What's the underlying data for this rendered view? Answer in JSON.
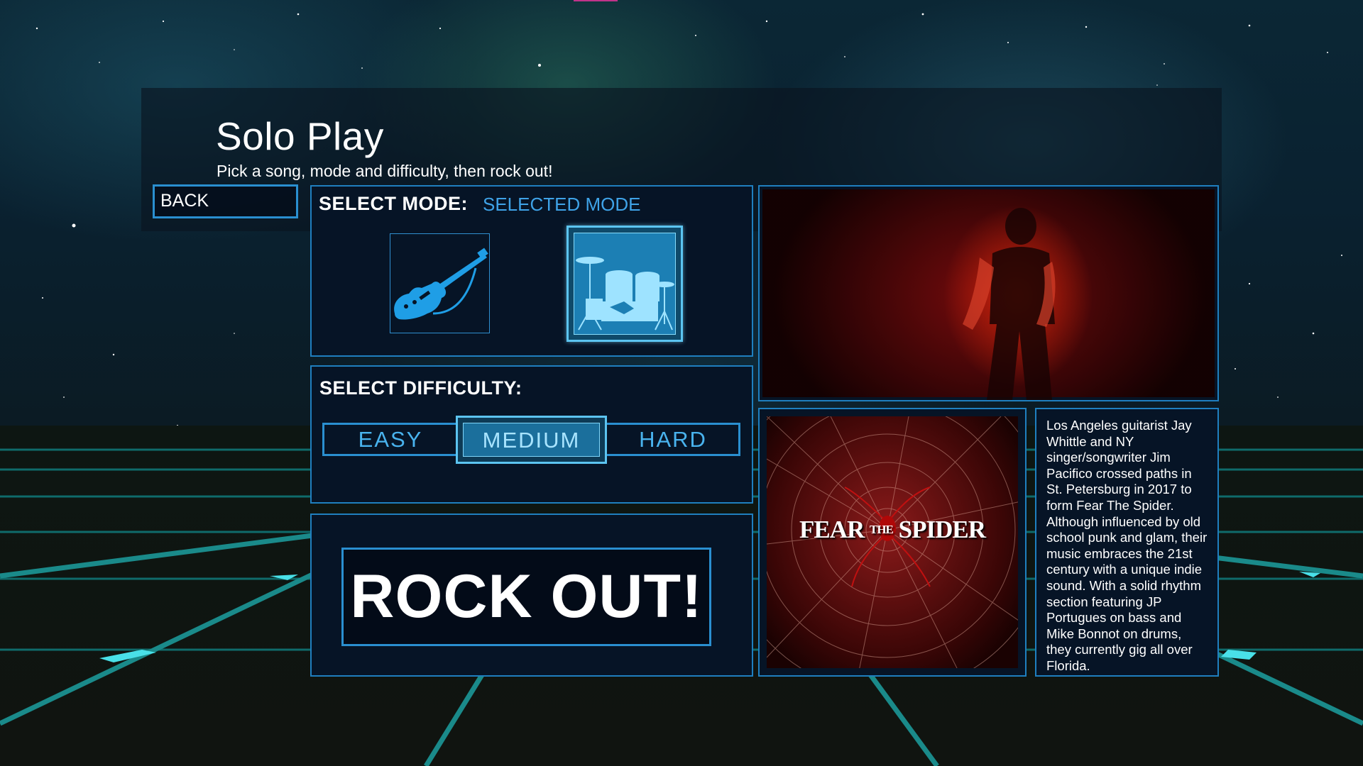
{
  "header": {
    "title": "Solo Play",
    "subtitle": "Pick a song, mode and difficulty, then rock out!"
  },
  "back_button": {
    "label": "BACK"
  },
  "mode": {
    "label": "SELECT MODE:",
    "selected_label": "SELECTED MODE",
    "options": [
      {
        "name": "guitar",
        "icon": "guitar-icon",
        "selected": false
      },
      {
        "name": "drums",
        "icon": "drums-icon",
        "selected": true
      }
    ]
  },
  "difficulty": {
    "label": "SELECT DIFFICULTY:",
    "options": [
      "EASY",
      "MEDIUM",
      "HARD"
    ],
    "selected": "MEDIUM"
  },
  "rock_out_button": {
    "label": "ROCK OUT!"
  },
  "song": {
    "band_logo_text": "FEAR THE SPIDER",
    "description": "Los Angeles guitarist Jay Whittle and NY singer/songwriter Jim Pacifico crossed paths in St. Petersburg in 2017 to form Fear The Spider. Although influenced by old school punk and glam, their music embraces the 21st century with a unique indie sound. With a solid rhythm section featuring JP Portugues on bass and Mike Bonnot on drums, they currently gig all over Florida."
  },
  "colors": {
    "accent": "#2a8fd0",
    "selected_highlight": "#5cc4f0",
    "mode_selected_text": "#3fa3e8",
    "panel_background": "#061426"
  }
}
